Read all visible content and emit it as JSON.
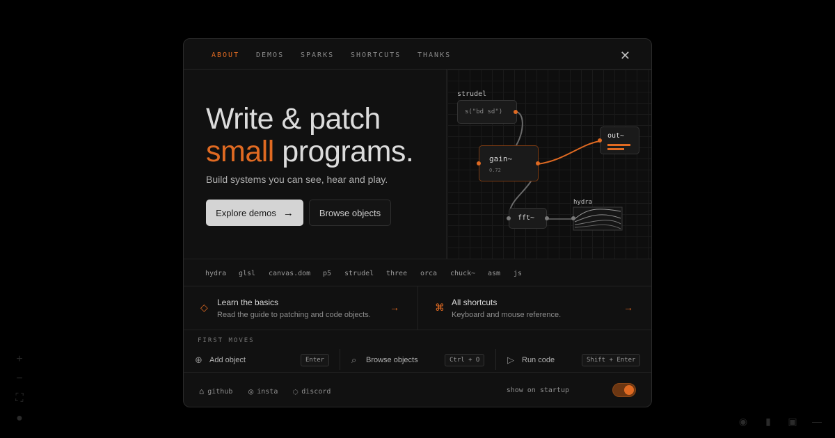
{
  "background": {
    "left_controls": [
      {
        "name": "plus-icon",
        "glyph": "+"
      },
      {
        "name": "minus-icon",
        "glyph": "−"
      },
      {
        "name": "fit-icon",
        "glyph": "⛶"
      },
      {
        "name": "lock-icon",
        "glyph": "●"
      }
    ],
    "bottom_controls": [
      {
        "name": "info-icon",
        "glyph": "◉"
      },
      {
        "name": "document-icon",
        "glyph": "▮"
      },
      {
        "name": "window-icon",
        "glyph": "▣"
      },
      {
        "name": "dash-icon",
        "glyph": "—"
      }
    ]
  },
  "modal": {
    "tabs": [
      {
        "label": "ABOUT",
        "active": true
      },
      {
        "label": "DEMOS",
        "active": false
      },
      {
        "label": "SPARKS",
        "active": false
      },
      {
        "label": "SHORTCUTS",
        "active": false
      },
      {
        "label": "THANKS",
        "active": false
      }
    ],
    "close_glyph": "✕",
    "hero": {
      "headline_line1": "Write & patch",
      "headline_accent": "small",
      "headline_rest": " programs.",
      "subline": "Build systems you can see, hear and play.",
      "primary_button": "Explore demos",
      "primary_arrow": "→",
      "secondary_button": "Browse objects"
    },
    "graph": {
      "strudel_label": "strudel",
      "strudel_code": "s(\"bd sd\")",
      "gain_label": "gain~",
      "gain_value": "0.72",
      "out_label": "out~",
      "fft_label": "fft~",
      "hydra_label": "hydra",
      "accent_color": "#e06a22"
    },
    "tags": [
      "hydra",
      "glsl",
      "canvas.dom",
      "p5",
      "strudel",
      "three",
      "orca",
      "chuck~",
      "asm",
      "js"
    ],
    "cards": [
      {
        "icon": "◇",
        "title": "Learn the basics",
        "desc": "Read the guide to patching and code objects.",
        "arrow": "→"
      },
      {
        "icon": "⌘",
        "title": "All shortcuts",
        "desc": "Keyboard and mouse reference.",
        "arrow": "→"
      }
    ],
    "first_moves_label": "FIRST MOVES",
    "moves": [
      {
        "icon": "⊕",
        "label": "Add object",
        "key": "Enter"
      },
      {
        "icon": "⌕",
        "label": "Browse objects",
        "key": "Ctrl + O"
      },
      {
        "icon": "▷",
        "label": "Run code",
        "key": "Shift + Enter"
      }
    ],
    "footer": {
      "links": [
        {
          "icon": "⌂",
          "label": "github"
        },
        {
          "icon": "◎",
          "label": "insta"
        },
        {
          "icon": "◌",
          "label": "discord"
        }
      ],
      "startup_label": "show on startup",
      "startup_on": true
    }
  }
}
